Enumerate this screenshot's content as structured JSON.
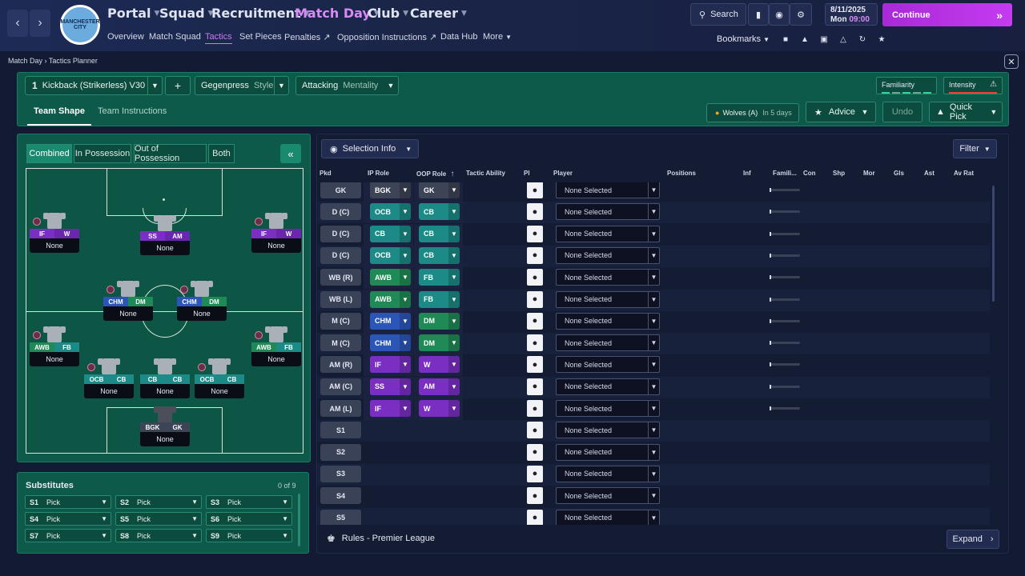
{
  "nav": {
    "main": [
      "Portal",
      "Squad",
      "Recruitment",
      "Match Day",
      "Club",
      "Career"
    ],
    "sub": [
      "Overview",
      "Match Squad",
      "Tactics",
      "Set Pieces",
      "Penalties",
      "Opposition Instructions",
      "Data Hub",
      "More"
    ],
    "crest_text": "MANCHESTER CITY",
    "search_label": "Search",
    "date": "8/11/2025",
    "day": "Mon",
    "time": "09:00",
    "continue_label": "Continue",
    "bookmarks_label": "Bookmarks"
  },
  "breadcrumb": [
    "Match Day",
    "Tactics Planner"
  ],
  "tactic": {
    "slot": "1",
    "name": "Kickback (Strikerless) V30",
    "add": "+",
    "style_value": "Gegenpress",
    "style_label": "Style",
    "mentality_value": "Attacking",
    "mentality_label": "Mentality",
    "familiarity": "Familiarity",
    "intensity": "Intensity",
    "tabs": [
      "Team Shape",
      "Team Instructions"
    ],
    "opponent": "Wolves (A)",
    "opponent_when": "In 5 days",
    "advice": "Advice",
    "undo": "Undo",
    "quick_pick": "Quick Pick"
  },
  "view_modes": [
    "Combined",
    "In Possession",
    "Out of Possession",
    "Both"
  ],
  "pitch_players": [
    {
      "ip": "IF",
      "oop": "W",
      "name": "None",
      "ipc": "r-purple",
      "oopc": "r-purple2",
      "pin": true
    },
    {
      "ip": "SS",
      "oop": "AM",
      "name": "None",
      "ipc": "r-purple",
      "oopc": "r-purple2",
      "pin": false
    },
    {
      "ip": "IF",
      "oop": "W",
      "name": "None",
      "ipc": "r-purple",
      "oopc": "r-purple2",
      "pin": true
    },
    {
      "ip": "CHM",
      "oop": "DM",
      "name": "None",
      "ipc": "r-blue",
      "oopc": "r-green",
      "pin": true
    },
    {
      "ip": "CHM",
      "oop": "DM",
      "name": "None",
      "ipc": "r-blue",
      "oopc": "r-green",
      "pin": true
    },
    {
      "ip": "AWB",
      "oop": "FB",
      "name": "None",
      "ipc": "r-green",
      "oopc": "r-teal",
      "pin": true
    },
    {
      "ip": "AWB",
      "oop": "FB",
      "name": "None",
      "ipc": "r-green",
      "oopc": "r-teal",
      "pin": true
    },
    {
      "ip": "OCB",
      "oop": "CB",
      "name": "None",
      "ipc": "r-teal",
      "oopc": "r-teal",
      "pin": true
    },
    {
      "ip": "CB",
      "oop": "CB",
      "name": "None",
      "ipc": "r-teal",
      "oopc": "r-teal",
      "pin": false
    },
    {
      "ip": "OCB",
      "oop": "CB",
      "name": "None",
      "ipc": "r-teal",
      "oopc": "r-teal",
      "pin": true
    },
    {
      "ip": "BGK",
      "oop": "GK",
      "name": "None",
      "ipc": "r-grey",
      "oopc": "r-grey",
      "pin": false,
      "gk": true
    }
  ],
  "substitutes": {
    "title": "Substitutes",
    "count": "0 of 9",
    "slots": [
      {
        "id": "S1",
        "label": "Pick"
      },
      {
        "id": "S2",
        "label": "Pick"
      },
      {
        "id": "S3",
        "label": "Pick"
      },
      {
        "id": "S4",
        "label": "Pick"
      },
      {
        "id": "S5",
        "label": "Pick"
      },
      {
        "id": "S6",
        "label": "Pick"
      },
      {
        "id": "S7",
        "label": "Pick"
      },
      {
        "id": "S8",
        "label": "Pick"
      },
      {
        "id": "S9",
        "label": "Pick"
      }
    ]
  },
  "table": {
    "selection_info": "Selection Info",
    "filter": "Filter",
    "columns": [
      "Pkd",
      "IP Role",
      "OOP Role",
      "Tactic Ability",
      "Pl",
      "Player",
      "Positions",
      "Inf",
      "Famili...",
      "Con",
      "Shp",
      "Mor",
      "Gls",
      "Ast",
      "Av Rat"
    ],
    "rows": [
      {
        "pos": "GK",
        "ip": "BGK",
        "oop": "GK",
        "ipc": "r-grey",
        "oopc": "r-grey",
        "player": "None Selected",
        "fam": true
      },
      {
        "pos": "D (C)",
        "ip": "OCB",
        "oop": "CB",
        "ipc": "r-teal",
        "oopc": "r-teal",
        "player": "None Selected",
        "fam": true
      },
      {
        "pos": "D (C)",
        "ip": "CB",
        "oop": "CB",
        "ipc": "r-teal",
        "oopc": "r-teal",
        "player": "None Selected",
        "fam": true
      },
      {
        "pos": "D (C)",
        "ip": "OCB",
        "oop": "CB",
        "ipc": "r-teal",
        "oopc": "r-teal",
        "player": "None Selected",
        "fam": true
      },
      {
        "pos": "WB (R)",
        "ip": "AWB",
        "oop": "FB",
        "ipc": "r-green",
        "oopc": "r-teal",
        "player": "None Selected",
        "fam": true
      },
      {
        "pos": "WB (L)",
        "ip": "AWB",
        "oop": "FB",
        "ipc": "r-green",
        "oopc": "r-teal",
        "player": "None Selected",
        "fam": true
      },
      {
        "pos": "M (C)",
        "ip": "CHM",
        "oop": "DM",
        "ipc": "r-blue",
        "oopc": "r-green",
        "player": "None Selected",
        "fam": true
      },
      {
        "pos": "M (C)",
        "ip": "CHM",
        "oop": "DM",
        "ipc": "r-blue",
        "oopc": "r-green",
        "player": "None Selected",
        "fam": true
      },
      {
        "pos": "AM (R)",
        "ip": "IF",
        "oop": "W",
        "ipc": "r-purple",
        "oopc": "r-purple",
        "player": "None Selected",
        "fam": true
      },
      {
        "pos": "AM (C)",
        "ip": "SS",
        "oop": "AM",
        "ipc": "r-purple",
        "oopc": "r-purple",
        "player": "None Selected",
        "fam": true
      },
      {
        "pos": "AM (L)",
        "ip": "IF",
        "oop": "W",
        "ipc": "r-purple",
        "oopc": "r-purple",
        "player": "None Selected",
        "fam": true
      },
      {
        "pos": "S1",
        "ip": "",
        "oop": "",
        "player": "None Selected",
        "fam": false
      },
      {
        "pos": "S2",
        "ip": "",
        "oop": "",
        "player": "None Selected",
        "fam": false
      },
      {
        "pos": "S3",
        "ip": "",
        "oop": "",
        "player": "None Selected",
        "fam": false
      },
      {
        "pos": "S4",
        "ip": "",
        "oop": "",
        "player": "None Selected",
        "fam": false
      },
      {
        "pos": "S5",
        "ip": "",
        "oop": "",
        "player": "None Selected",
        "fam": false
      }
    ],
    "rules": "Rules - Premier League",
    "expand": "Expand"
  },
  "colors": {
    "accent": "#c53bf0",
    "panel": "#0e5a4a",
    "background": "#131b34"
  }
}
